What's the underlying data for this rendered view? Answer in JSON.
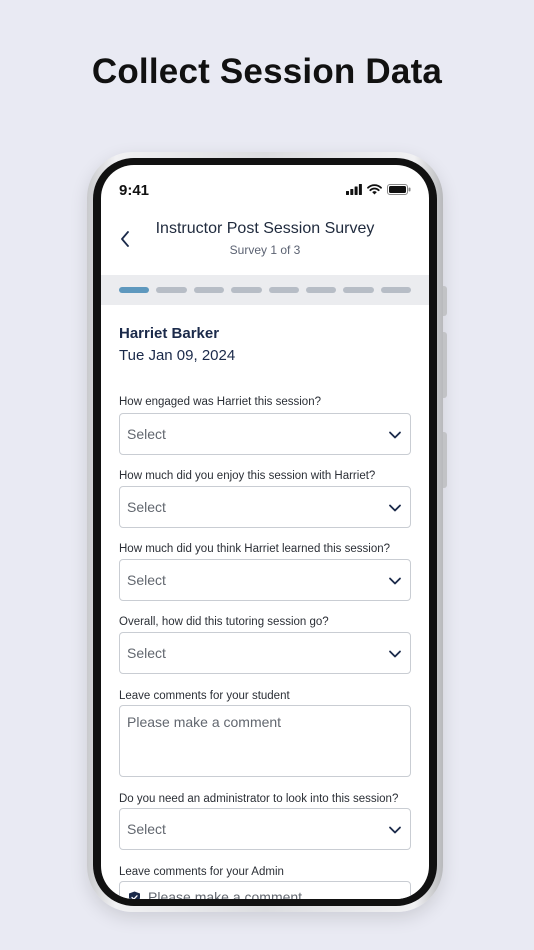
{
  "headline": "Collect Session Data",
  "status_bar": {
    "time": "9:41"
  },
  "nav": {
    "title": "Instructor Post Session Survey",
    "subtitle": "Survey 1 of 3"
  },
  "progress": {
    "total_steps": 8,
    "current_step": 1
  },
  "student": {
    "name": "Harriet Barker",
    "date": "Tue Jan 09, 2024"
  },
  "questions": [
    {
      "label": "How engaged was Harriet this session?",
      "value": "Select"
    },
    {
      "label": "How much did you enjoy this session with Harriet?",
      "value": "Select"
    },
    {
      "label": "How much did you think Harriet learned this session?",
      "value": "Select"
    },
    {
      "label": "Overall, how did this tutoring session go?",
      "value": "Select"
    }
  ],
  "student_comment": {
    "label": "Leave comments for your student",
    "placeholder": "Please make a comment"
  },
  "admin_question": {
    "label": "Do you need an administrator to look into this session?",
    "value": "Select"
  },
  "admin_comment": {
    "label": "Leave comments for your Admin",
    "placeholder": "Please make a comment"
  },
  "icons": {
    "back": "chevron-left-icon",
    "dropdown": "chevron-down-icon",
    "admin_comment": "shield-icon",
    "status": [
      "signal-icon",
      "wifi-icon",
      "battery-icon"
    ]
  },
  "colors": {
    "accent": "#5e98be",
    "title_text": "#1b2a4a",
    "background": "#e9eaf3"
  }
}
